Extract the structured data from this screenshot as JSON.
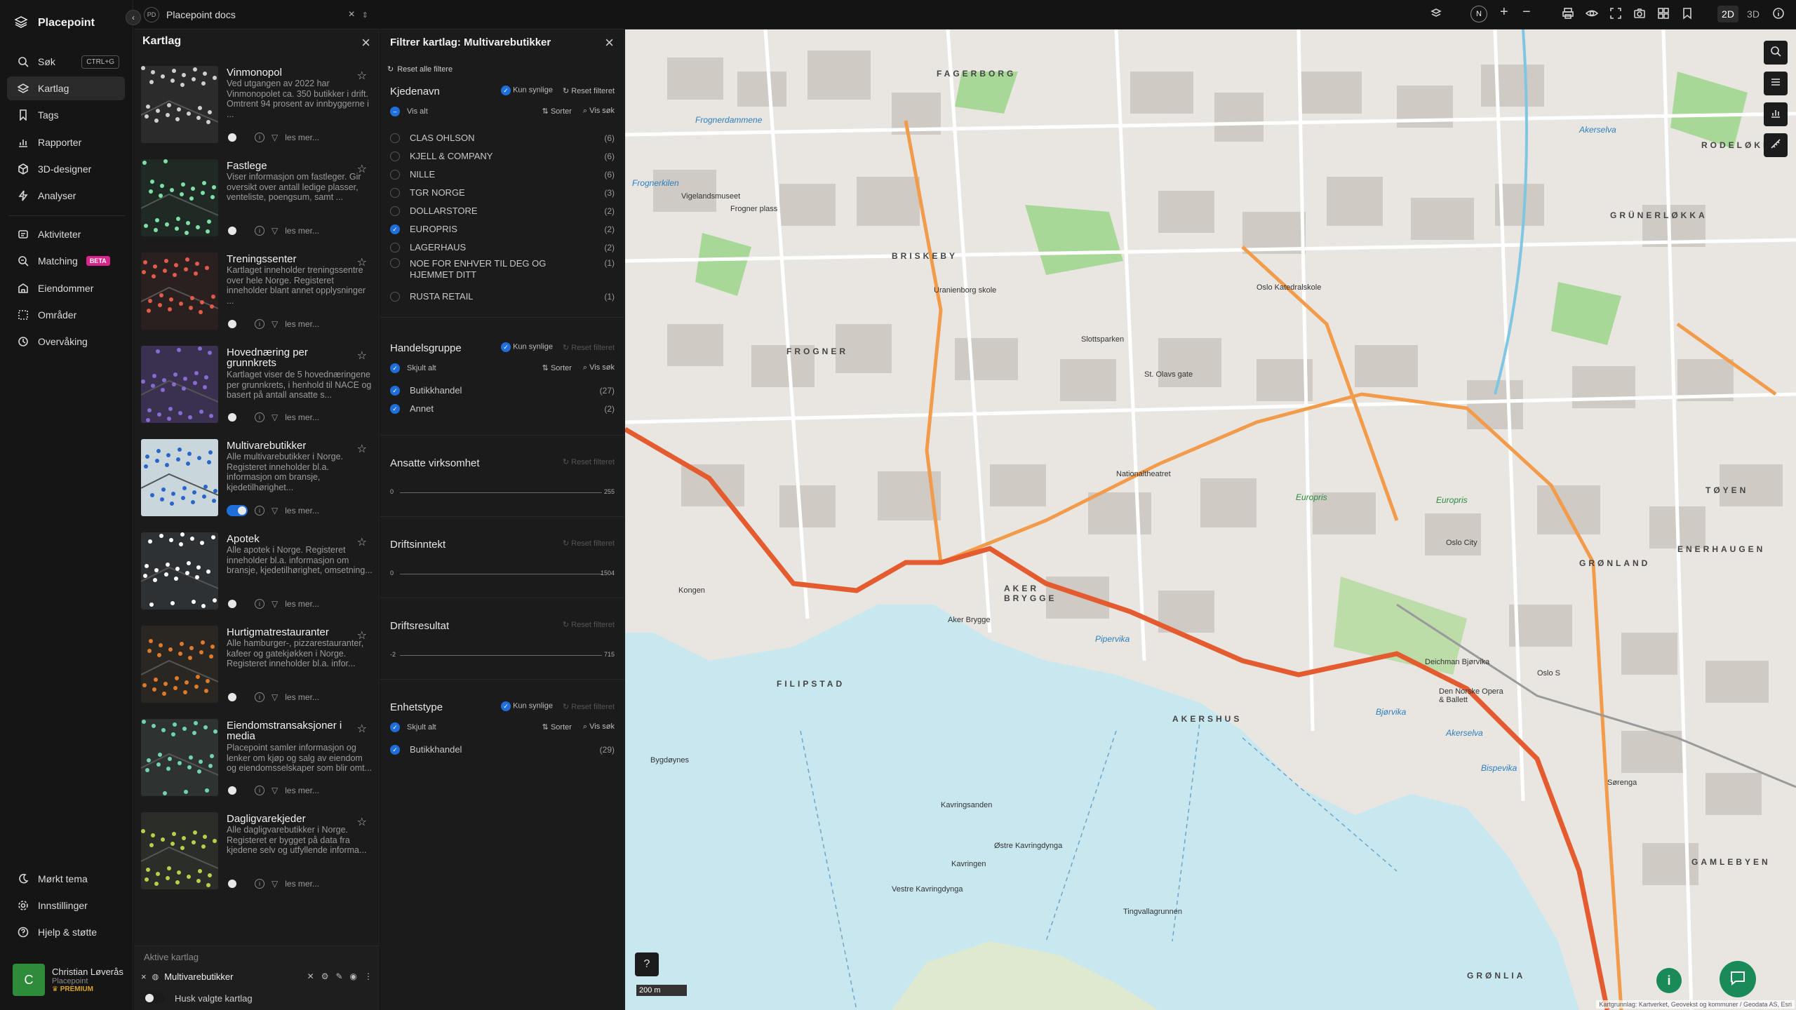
{
  "app": {
    "name": "Placepoint",
    "tab_label": "Placepoint docs",
    "tab_badge": "PD"
  },
  "nav": {
    "items": [
      {
        "label": "Søk",
        "icon": "search-icon",
        "shortcut": "CTRL+G"
      },
      {
        "label": "Kartlag",
        "icon": "layers-icon",
        "active": true
      },
      {
        "label": "Tags",
        "icon": "bookmark-icon"
      },
      {
        "label": "Rapporter",
        "icon": "chart-icon"
      },
      {
        "label": "3D-designer",
        "icon": "cube-icon"
      },
      {
        "label": "Analyser",
        "icon": "bolt-icon"
      },
      {
        "label": "Aktiviteter",
        "icon": "activity-icon"
      },
      {
        "label": "Matching",
        "icon": "match-icon",
        "badge": "BETA"
      },
      {
        "label": "Eiendommer",
        "icon": "building-icon"
      },
      {
        "label": "Områder",
        "icon": "area-icon"
      },
      {
        "label": "Overvåking",
        "icon": "watch-icon"
      }
    ],
    "bottom": [
      {
        "label": "Mørkt tema",
        "icon": "moon-icon"
      },
      {
        "label": "Innstillinger",
        "icon": "gear-icon"
      },
      {
        "label": "Hjelp & støtte",
        "icon": "help-icon"
      }
    ],
    "user": {
      "initial": "C",
      "name": "Christian Løverås",
      "org": "Placepoint",
      "plan": "PREMIUM"
    }
  },
  "layers": {
    "title": "Kartlag",
    "cards": [
      {
        "title": "Vinmonopol",
        "desc": "Ved utgangen av 2022 har Vinmonopolet ca. 350 butikker i drift. Omtrent 94 prosent av innbyggerne i ...",
        "on": false
      },
      {
        "title": "Fastlege",
        "desc": "Viser informasjon om fastleger. Gir oversikt over antall ledige plasser, venteliste, poengsum, samt ...",
        "on": false
      },
      {
        "title": "Treningssenter",
        "desc": "Kartlaget inneholder treningssentre over hele Norge. Registeret inneholder blant annet opplysninger ...",
        "on": false
      },
      {
        "title": "Hovednæring per grunnkrets",
        "desc": "Kartlaget viser de 5 hovednæringene per grunnkrets, i henhold til NACE og basert på antall ansatte s...",
        "on": false
      },
      {
        "title": "Multivarebutikker",
        "desc": "Alle multivarebutikker i Norge. Registeret inneholder bl.a. informasjon om bransje, kjedetilhørighet...",
        "on": true
      },
      {
        "title": "Apotek",
        "desc": "Alle apotek i Norge. Registeret inneholder bl.a. informasjon om bransje, kjedetilhørighet, omsetning...",
        "on": false
      },
      {
        "title": "Hurtigmatrestauranter",
        "desc": "Alle hamburger-, pizzarestauranter, kafeer og gatekjøkken i Norge. Registeret inneholder bl.a. infor...",
        "on": false
      },
      {
        "title": "Eiendomstransaksjoner i media",
        "desc": "Placepoint samler informasjon og lenker om kjøp og salg av eiendom og eiendomsselskaper som blir omt...",
        "on": false
      },
      {
        "title": "Dagligvarekjeder",
        "desc": "Alle dagligvarebutikker i Norge. Registeret er bygget på data fra kjedene selv og utfyllende informa...",
        "on": false
      }
    ],
    "more_label": "les mer...",
    "active_title": "Aktive kartlag",
    "active_layer": "Multivarebutikker",
    "remember_label": "Husk valgte kartlag"
  },
  "filter": {
    "title": "Filtrer kartlag: Multivarebutikker",
    "reset_all": "Reset alle filtere",
    "only_visible": "Kun synlige",
    "reset_filter": "Reset filteret",
    "sort": "Sorter",
    "show_search": "Vis søk",
    "chains": {
      "title": "Kjedenavn",
      "toggle_all": "Vis alt",
      "items": [
        {
          "label": "CLAS OHLSON",
          "count": "(6)",
          "checked": false
        },
        {
          "label": "KJELL & COMPANY",
          "count": "(6)",
          "checked": false
        },
        {
          "label": "NILLE",
          "count": "(6)",
          "checked": false
        },
        {
          "label": "TGR NORGE",
          "count": "(3)",
          "checked": false
        },
        {
          "label": "DOLLARSTORE",
          "count": "(2)",
          "checked": false
        },
        {
          "label": "EUROPRIS",
          "count": "(2)",
          "checked": true
        },
        {
          "label": "LAGERHAUS",
          "count": "(2)",
          "checked": false
        },
        {
          "label": "NOE FOR ENHVER TIL DEG OG HJEMMET DITT",
          "count": "(1)",
          "checked": false
        },
        {
          "label": "RUSTA RETAIL",
          "count": "(1)",
          "checked": false
        }
      ]
    },
    "groups": {
      "title": "Handelsgruppe",
      "toggle_all": "Skjult alt",
      "items": [
        {
          "label": "Butikkhandel",
          "count": "(27)",
          "checked": true
        },
        {
          "label": "Annet",
          "count": "(2)",
          "checked": true
        }
      ]
    },
    "employees": {
      "title": "Ansatte virksomhet",
      "min": "0",
      "max": "255"
    },
    "revenue": {
      "title": "Driftsinntekt",
      "min": "0",
      "max": "1504"
    },
    "result": {
      "title": "Driftsresultat",
      "min": "-2",
      "max": "715"
    },
    "unit": {
      "title": "Enhetstype",
      "toggle_all": "Skjult alt",
      "items": [
        {
          "label": "Butikkhandel",
          "count": "(29)",
          "checked": true
        }
      ]
    }
  },
  "toolbar": {
    "north": "N",
    "mode_2d": "2D",
    "mode_3d": "3D",
    "zoom_in": "+",
    "zoom_out": "−"
  },
  "map": {
    "districts": [
      "FAGERBORG",
      "BRISKEBY",
      "FROGNER",
      "RODELØKKA",
      "GRÜNERLØKKA",
      "TØYEN",
      "ENERHAUGEN",
      "GRØNLAND",
      "AKER BRYGGE",
      "FILIPSTAD",
      "AKERSHUS",
      "GAMLEBYEN",
      "GRØNLIA"
    ],
    "labels": [
      "Frognerdammene",
      "Akerselva",
      "Vigelandsmuseet",
      "Frogner plass",
      "Uranienborg skole",
      "Slottsparken",
      "St. Olavs gate",
      "Oslo Katedralskole",
      "Nationaltheatret",
      "Europris",
      "Europris",
      "Oslo City",
      "Aker Brygge",
      "Pipervika",
      "Kavringsanden",
      "Østre Kavringdynga",
      "Vestre Kavringdynga",
      "Kavringen",
      "Tingvallagrunnen",
      "Bispevika",
      "Bjørvika",
      "Akerselva",
      "Deichman Bjørvika",
      "Den Norske Opera & Ballett",
      "Oslo S",
      "Frognerkilen",
      "Bygdøynes",
      "Kongen",
      "Sørenga"
    ],
    "scale": "200 m",
    "attribution": "Kartgrunnlag: Kartverket, Geovekst og kommuner / Geodata AS, Esri"
  }
}
